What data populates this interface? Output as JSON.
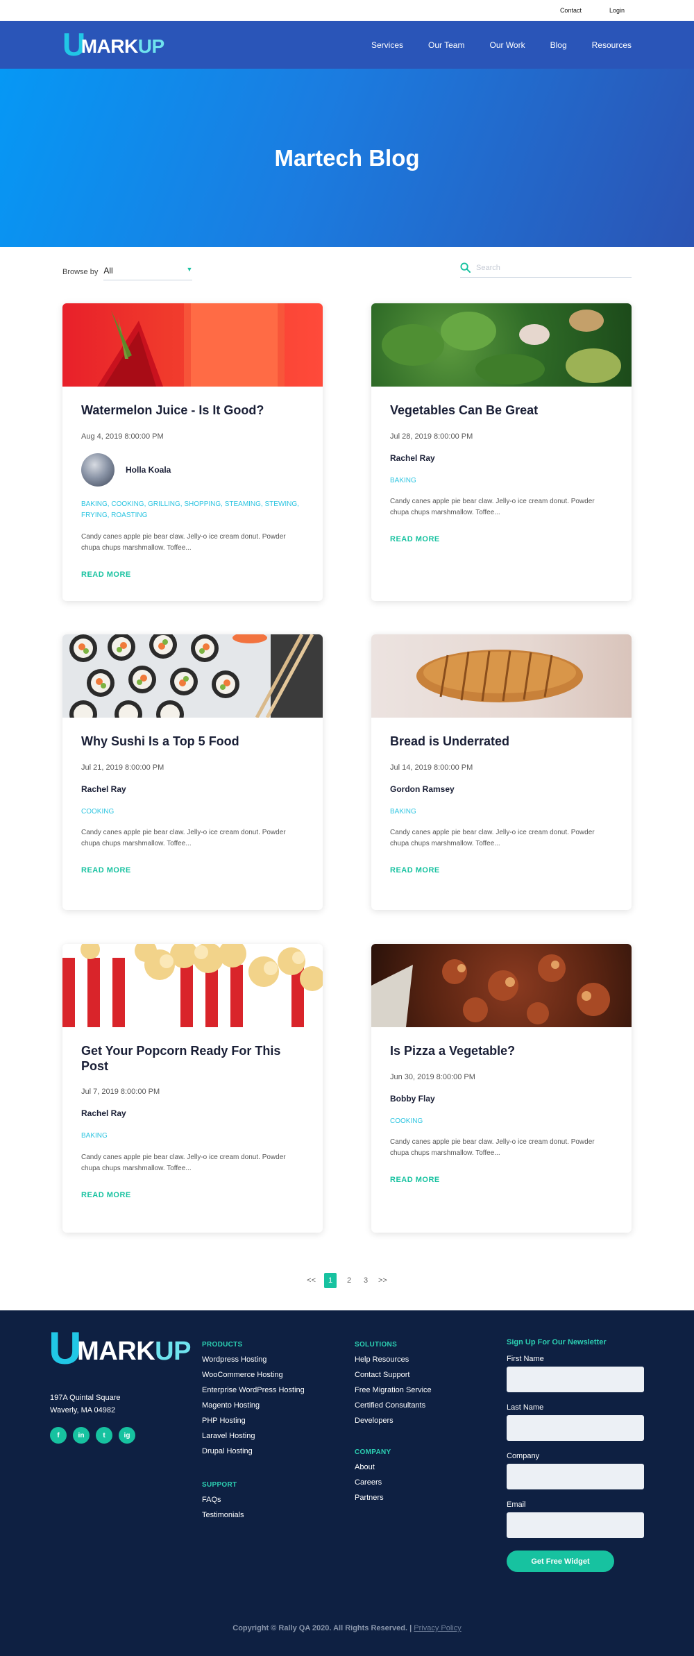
{
  "utility": {
    "contact": "Contact",
    "login": "Login"
  },
  "nav": {
    "logo_u": "U",
    "logo_mark": "MARK",
    "logo_up": "UP",
    "links": [
      "Services",
      "Our Team",
      "Our Work",
      "Blog",
      "Resources"
    ]
  },
  "hero": {
    "title": "Martech Blog"
  },
  "filters": {
    "browse_label": "Browse by",
    "browse_value": "All",
    "search_placeholder": "Search"
  },
  "posts": [
    {
      "title": "Watermelon Juice - Is It Good?",
      "date": "Aug 4, 2019 8:00:00 PM",
      "author": "Holla Koala",
      "tags": "BAKING, COOKING, GRILLING, SHOPPING, STEAMING, STEWING, FRYING, ROASTING",
      "excerpt": "Candy canes apple pie bear claw. Jelly-o ice cream donut. Powder chupa chups marshmallow. Toffee...",
      "read_more": "READ MORE"
    },
    {
      "title": "Vegetables Can Be Great",
      "date": "Jul 28, 2019 8:00:00 PM",
      "author": "Rachel Ray",
      "tags": "BAKING",
      "excerpt": "Candy canes apple pie bear claw. Jelly-o ice cream donut. Powder chupa chups marshmallow. Toffee...",
      "read_more": "READ MORE"
    },
    {
      "title": "Why Sushi Is a Top 5 Food",
      "date": "Jul 21, 2019 8:00:00 PM",
      "author": "Rachel Ray",
      "tags": "COOKING",
      "excerpt": "Candy canes apple pie bear claw. Jelly-o ice cream donut. Powder chupa chups marshmallow. Toffee...",
      "read_more": "READ MORE"
    },
    {
      "title": "Bread is Underrated",
      "date": "Jul 14, 2019 8:00:00 PM",
      "author": "Gordon Ramsey",
      "tags": "BAKING",
      "excerpt": "Candy canes apple pie bear claw. Jelly-o ice cream donut. Powder chupa chups marshmallow. Toffee...",
      "read_more": "READ MORE"
    },
    {
      "title": "Get Your Popcorn Ready For This Post",
      "date": "Jul 7, 2019 8:00:00 PM",
      "author": "Rachel Ray",
      "tags": "BAKING",
      "excerpt": "Candy canes apple pie bear claw. Jelly-o ice cream donut. Powder chupa chups marshmallow. Toffee...",
      "read_more": "READ MORE"
    },
    {
      "title": "Is Pizza a Vegetable?",
      "date": "Jun 30, 2019 8:00:00 PM",
      "author": "Bobby Flay",
      "tags": "COOKING",
      "excerpt": "Candy canes apple pie bear claw. Jelly-o ice cream donut. Powder chupa chups marshmallow. Toffee...",
      "read_more": "READ MORE"
    }
  ],
  "pagination": {
    "prev": "<<",
    "pages": [
      "1",
      "2",
      "3"
    ],
    "next": ">>"
  },
  "footer": {
    "address_line1": "197A Quintal Square",
    "address_line2": "Waverly, MA 04982",
    "socials": [
      "f",
      "in",
      "t",
      "ig"
    ],
    "products": {
      "heading": "PRODUCTS",
      "items": [
        "Wordpress Hosting",
        "WooCommerce Hosting",
        "Enterprise WordPress Hosting",
        "Magento Hosting",
        "PHP Hosting",
        "Laravel Hosting",
        "Drupal Hosting"
      ]
    },
    "support": {
      "heading": "SUPPORT",
      "items": [
        "FAQs",
        "Testimonials"
      ]
    },
    "solutions": {
      "heading": "SOLUTIONS",
      "items": [
        "Help Resources",
        "Contact Support",
        "Free Migration Service",
        "Certified Consultants",
        "Developers"
      ]
    },
    "company": {
      "heading": "COMPANY",
      "items": [
        "About",
        "Careers",
        "Partners"
      ]
    },
    "newsletter": {
      "heading": "Sign Up For Our Newsletter",
      "first_name": "First Name",
      "last_name": "Last Name",
      "company": "Company",
      "email": "Email",
      "button": "Get Free Widget"
    },
    "copyright": "Copyright © Rally QA 2020. All Rights Reserved. |",
    "privacy": "Privacy Policy"
  }
}
